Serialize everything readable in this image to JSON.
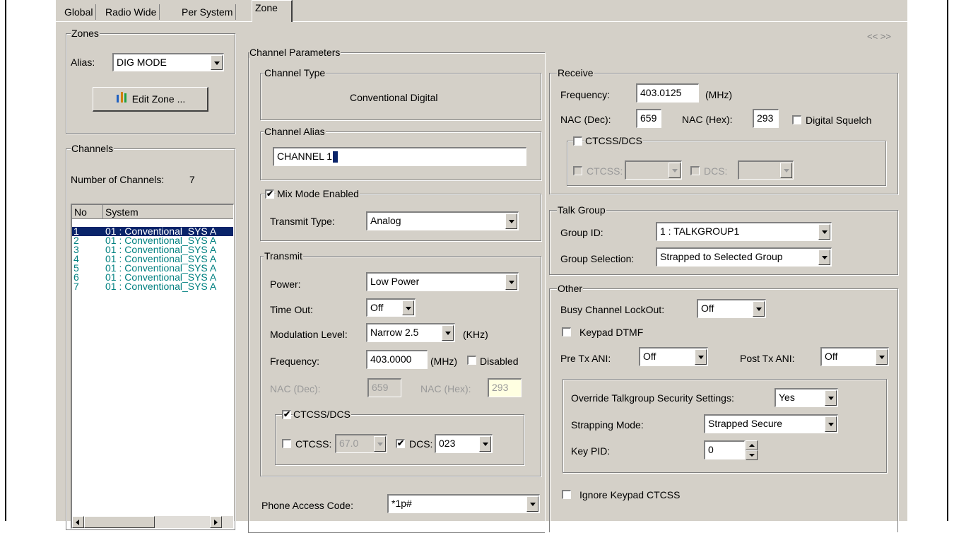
{
  "tabs": [
    "Global",
    "Radio Wide",
    "Per System",
    "Zone"
  ],
  "nav_arrows": "<<  >>",
  "zones": {
    "title": "Zones",
    "alias_label": "Alias:",
    "alias_value": "DIG MODE",
    "edit_zone_button": "Edit Zone ..."
  },
  "channels": {
    "title": "Channels",
    "count_label": "Number of Channels:",
    "count_value": "7",
    "columns": [
      "No",
      "System"
    ],
    "rows": [
      {
        "no": "1",
        "system": "01 : Conventional_SYS A"
      },
      {
        "no": "2",
        "system": "01 : Conventional_SYS A"
      },
      {
        "no": "3",
        "system": "01 : Conventional_SYS A"
      },
      {
        "no": "4",
        "system": "01 : Conventional_SYS A"
      },
      {
        "no": "5",
        "system": "01 : Conventional_SYS A"
      },
      {
        "no": "6",
        "system": "01 : Conventional_SYS A"
      },
      {
        "no": "7",
        "system": "01 : Conventional_SYS A"
      }
    ]
  },
  "channel_parameters": {
    "title": "Channel Parameters",
    "channel_type": {
      "title": "Channel Type",
      "value": "Conventional Digital"
    },
    "channel_alias": {
      "title": "Channel Alias",
      "value": "CHANNEL 1"
    },
    "mix_mode": {
      "label": "Mix Mode Enabled",
      "checked": true,
      "transmit_type_label": "Transmit Type:",
      "transmit_type_value": "Analog"
    },
    "transmit": {
      "title": "Transmit",
      "power_label": "Power:",
      "power_value": "Low Power",
      "timeout_label": "Time Out:",
      "timeout_value": "Off",
      "modulation_label": "Modulation Level:",
      "modulation_value": "Narrow 2.5",
      "modulation_unit": "(KHz)",
      "frequency_label": "Frequency:",
      "frequency_value": "403.0000",
      "frequency_unit": "(MHz)",
      "disabled_label": "Disabled",
      "nac_dec_label": "NAC (Dec):",
      "nac_dec_value": "659",
      "nac_hex_label": "NAC (Hex):",
      "nac_hex_value": "293",
      "ctcss_dcs_label": "CTCSS/DCS",
      "ctcss_label": "CTCSS:",
      "ctcss_value": "67.0",
      "dcs_label": "DCS:",
      "dcs_value": "023"
    },
    "phone_access_label": "Phone Access Code:",
    "phone_access_value": "*1p#"
  },
  "receive": {
    "title": "Receive",
    "frequency_label": "Frequency:",
    "frequency_value": "403.0125",
    "frequency_unit": "(MHz)",
    "nac_dec_label": "NAC (Dec):",
    "nac_dec_value": "659",
    "nac_hex_label": "NAC (Hex):",
    "nac_hex_value": "293",
    "digital_squelch_label": "Digital Squelch",
    "ctcss_dcs_label": "CTCSS/DCS",
    "ctcss_label": "CTCSS:",
    "dcs_label": "DCS:"
  },
  "talk_group": {
    "title": "Talk Group",
    "group_id_label": "Group ID:",
    "group_id_value": "1 : TALKGROUP1",
    "group_selection_label": "Group Selection:",
    "group_selection_value": "Strapped to Selected Group"
  },
  "other": {
    "title": "Other",
    "busy_lockout_label": "Busy Channel LockOut:",
    "busy_lockout_value": "Off",
    "keypad_dtmf_label": "Keypad DTMF",
    "pre_tx_ani_label": "Pre Tx ANI:",
    "pre_tx_ani_value": "Off",
    "post_tx_ani_label": "Post Tx ANI:",
    "post_tx_ani_value": "Off",
    "override_label": "Override Talkgroup Security Settings:",
    "override_value": "Yes",
    "strapping_label": "Strapping Mode:",
    "strapping_value": "Strapped Secure",
    "key_pid_label": "Key PID:",
    "key_pid_value": "0",
    "ignore_keypad_label": "Ignore Keypad CTCSS"
  }
}
